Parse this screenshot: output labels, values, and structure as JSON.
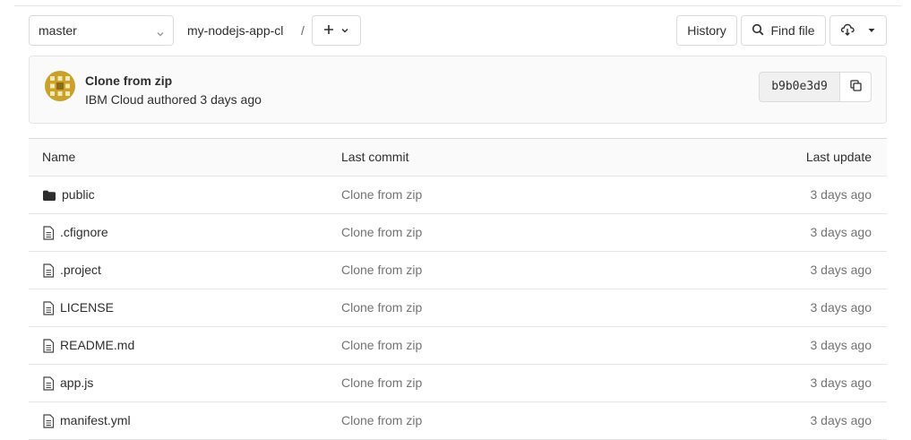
{
  "toolbar": {
    "branch": "master",
    "path_root": "my-nodejs-app-cl",
    "path_separator": "/",
    "history_label": "History",
    "find_file_label": "Find file"
  },
  "commit": {
    "title": "Clone from zip",
    "meta": "IBM Cloud authored 3 days ago",
    "sha": "b9b0e3d9"
  },
  "table": {
    "headers": {
      "name": "Name",
      "last_commit": "Last commit",
      "last_update": "Last update"
    },
    "rows": [
      {
        "name": "public",
        "type": "folder",
        "last_commit": "Clone from zip",
        "last_update": "3 days ago"
      },
      {
        "name": ".cfignore",
        "type": "file",
        "last_commit": "Clone from zip",
        "last_update": "3 days ago"
      },
      {
        "name": ".project",
        "type": "file",
        "last_commit": "Clone from zip",
        "last_update": "3 days ago"
      },
      {
        "name": "LICENSE",
        "type": "file",
        "last_commit": "Clone from zip",
        "last_update": "3 days ago"
      },
      {
        "name": "README.md",
        "type": "file",
        "last_commit": "Clone from zip",
        "last_update": "3 days ago"
      },
      {
        "name": "app.js",
        "type": "file",
        "last_commit": "Clone from zip",
        "last_update": "3 days ago"
      },
      {
        "name": "manifest.yml",
        "type": "file",
        "last_commit": "Clone from zip",
        "last_update": "3 days ago"
      }
    ]
  },
  "icons": {
    "folder": "folder-icon",
    "file": "file-icon",
    "search": "search-icon",
    "download": "download-icon",
    "copy": "copy-icon",
    "plus": "plus-icon",
    "chevron": "chevron-down-icon"
  },
  "colors": {
    "avatar_gold": "#c9a227",
    "muted_text": "#737373"
  }
}
